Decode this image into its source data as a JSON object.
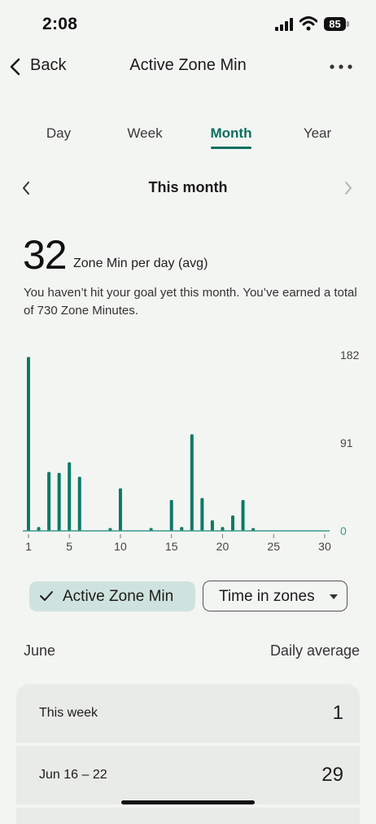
{
  "status_bar": {
    "time": "2:08",
    "battery": "85"
  },
  "nav": {
    "back_label": "Back",
    "title": "Active Zone Min"
  },
  "tabs": [
    {
      "label": "Day",
      "active": false
    },
    {
      "label": "Week",
      "active": false
    },
    {
      "label": "Month",
      "active": true
    },
    {
      "label": "Year",
      "active": false
    }
  ],
  "period": {
    "title": "This month"
  },
  "summary": {
    "value": "32",
    "label": "Zone Min per day (avg)",
    "description": "You haven’t hit your goal yet this month. You’ve earned a total of 730 Zone Minutes."
  },
  "chart_data": {
    "type": "bar",
    "x": [
      1,
      2,
      3,
      4,
      5,
      6,
      7,
      8,
      9,
      10,
      11,
      12,
      13,
      14,
      15,
      16,
      17,
      18,
      19,
      20,
      21,
      22,
      23,
      24,
      25,
      26,
      27,
      28,
      29,
      30
    ],
    "values": [
      180,
      4,
      61,
      60,
      71,
      56,
      0,
      0,
      3,
      44,
      0,
      0,
      3,
      0,
      32,
      4,
      100,
      34,
      11,
      4,
      16,
      32,
      3,
      0,
      0,
      0,
      0,
      0,
      0,
      0
    ],
    "x_tick_labels": [
      "1",
      "5",
      "10",
      "15",
      "20",
      "25",
      "30"
    ],
    "y_tick_labels": [
      "182",
      "91",
      "0"
    ],
    "ylim": [
      0,
      182
    ],
    "bar_color": "#0b7a66",
    "axis_color": "#3a9a8c"
  },
  "filters": {
    "active_label": "Active Zone Min",
    "dropdown_label": "Time in zones"
  },
  "list": {
    "month": "June",
    "avg_header": "Daily average",
    "rows": [
      {
        "label": "This week",
        "value": "1"
      },
      {
        "label": "Jun 16 – 22",
        "value": "29"
      }
    ]
  }
}
